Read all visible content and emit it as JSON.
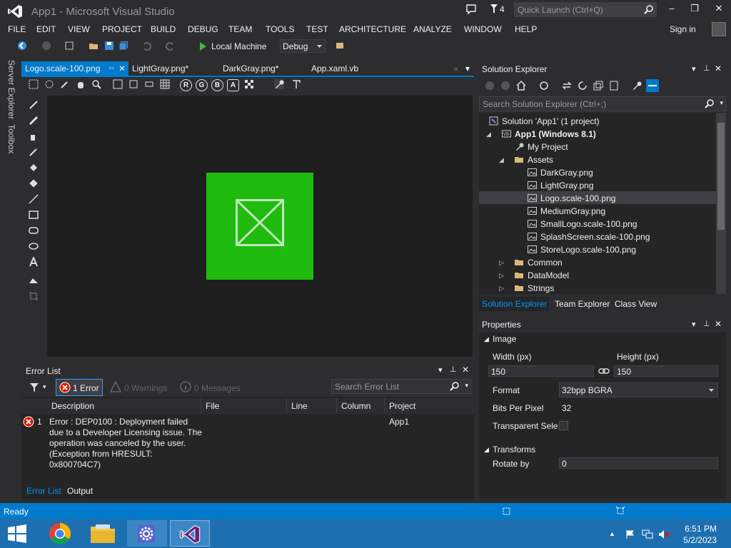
{
  "titlebar": {
    "title": "App1 - Microsoft Visual Studio",
    "flag_count": "4",
    "quick_launch_placeholder": "Quick Launch (Ctrl+Q)",
    "minimize": "–",
    "restore": "❐",
    "close": "✕"
  },
  "menu": {
    "items": [
      "FILE",
      "EDIT",
      "VIEW",
      "PROJECT",
      "BUILD",
      "DEBUG",
      "TEAM",
      "TOOLS",
      "TEST",
      "ARCHITECTURE",
      "ANALYZE",
      "WINDOW",
      "HELP"
    ],
    "sign_in": "Sign in"
  },
  "toolbar": {
    "run_target": "Local Machine",
    "configuration": "Debug"
  },
  "side_tabs": [
    "Server Explorer",
    "Toolbox"
  ],
  "doc_tabs": [
    {
      "label": "Logo.scale-100.png",
      "active": true
    },
    {
      "label": "LightGray.png*"
    },
    {
      "label": "DarkGray.png*"
    },
    {
      "label": "App.xaml.vb"
    }
  ],
  "image_toolbar": {
    "channel_r": "R",
    "channel_g": "G",
    "channel_b": "B",
    "channel_a": "A"
  },
  "error_list": {
    "title": "Error List",
    "errors_btn": "1 Error",
    "warnings_btn": "0 Warnings",
    "messages_btn": "0 Messages",
    "search_placeholder": "Search Error List",
    "columns": [
      "Description",
      "File",
      "Line",
      "Column",
      "Project"
    ],
    "rows": [
      {
        "num": "1",
        "description": "Error : DEP0100 : Deployment failed due to a Developer Licensing issue. The operation was canceled by the user. (Exception from HRESULT: 0x800704C7)",
        "file": "",
        "line": "",
        "column": "",
        "project": "App1"
      }
    ],
    "bottom_tabs": [
      "Error List",
      "Output"
    ]
  },
  "solution_explorer": {
    "title": "Solution Explorer",
    "search_placeholder": "Search Solution Explorer (Ctrl+;)",
    "tree": {
      "solution": "Solution 'App1' (1 project)",
      "project": "App1 (Windows 8.1)",
      "my_project": "My Project",
      "assets": "Assets",
      "files": [
        "DarkGray.png",
        "LightGray.png",
        "Logo.scale-100.png",
        "MediumGray.png",
        "SmallLogo.scale-100.png",
        "SplashScreen.scale-100.png",
        "StoreLogo.scale-100.png"
      ],
      "folders": [
        "Common",
        "DataModel",
        "Strings"
      ]
    },
    "bottom_tabs": [
      "Solution Explorer",
      "Team Explorer",
      "Class View"
    ]
  },
  "properties": {
    "title": "Properties",
    "section_image": "Image",
    "width_label": "Width (px)",
    "height_label": "Height (px)",
    "width_value": "150",
    "height_value": "150",
    "format_label": "Format",
    "format_value": "32bpp BGRA",
    "bpp_label": "Bits Per Pixel",
    "bpp_value": "32",
    "transparent_label": "Transparent Sele",
    "section_transforms": "Transforms",
    "rotate_label": "Rotate by",
    "rotate_value": "0"
  },
  "status": {
    "text": "Ready"
  },
  "taskbar": {
    "time": "6:51 PM",
    "date": "5/2/2023"
  },
  "colors": {
    "accent": "#007acc",
    "logo_green": "#1fbb0e",
    "error_red": "#e51400",
    "taskbar": "#1e6fb0"
  }
}
